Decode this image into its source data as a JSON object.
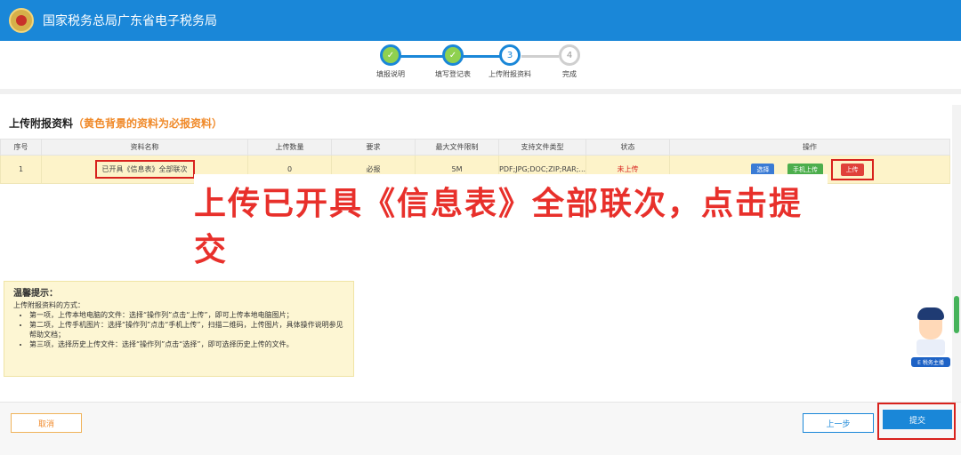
{
  "header": {
    "title": "国家税务总局广东省电子税务局"
  },
  "steps": [
    {
      "number": "",
      "label": "填报说明",
      "status": "done"
    },
    {
      "number": "",
      "label": "填写登记表",
      "status": "done"
    },
    {
      "number": "3",
      "label": "上传附报资料",
      "status": "current"
    },
    {
      "number": "4",
      "label": "完成",
      "status": "todo"
    }
  ],
  "section": {
    "title": "上传附报资料",
    "hint": "（黄色背景的资料为必报资料）"
  },
  "table": {
    "headers": [
      "序号",
      "资料名称",
      "上传数量",
      "要求",
      "最大文件限制",
      "支持文件类型",
      "状态",
      "操作"
    ],
    "rows": [
      {
        "index": "1",
        "name": "已开具《信息表》全部联次",
        "count": "0",
        "requirement": "必报",
        "max_size": "5M",
        "types": "PDF;JPG;DOC;ZIP;RAR;...",
        "status": "未上传"
      }
    ],
    "ops": {
      "select": "选择",
      "mobile": "手机上传",
      "upload": "上传"
    }
  },
  "overlay": {
    "text": "上传已开具《信息表》全部联次，点击提交"
  },
  "tips": {
    "title": "温馨提示：",
    "intro": "上传附报资料的方式：",
    "items": [
      "第一项，上传本地电脑的文件：选择“操作列”点击“上传”，即可上传本地电脑图片；",
      "第二项，上传手机图片：选择“操作列”点击“手机上传”，扫描二维码，上传图片，具体操作说明参见帮助文档；",
      "第三项，选择历史上传文件：选择“操作列”点击“选择”，即可选择历史上传的文件。"
    ]
  },
  "mascot": {
    "badge": "E 税务主播"
  },
  "footer": {
    "cancel": "取消",
    "prev": "上一步",
    "submit": "提交"
  },
  "colors": {
    "primary": "#1a87d8",
    "warning": "#d8221d",
    "required_bg": "#fdf3c9"
  }
}
